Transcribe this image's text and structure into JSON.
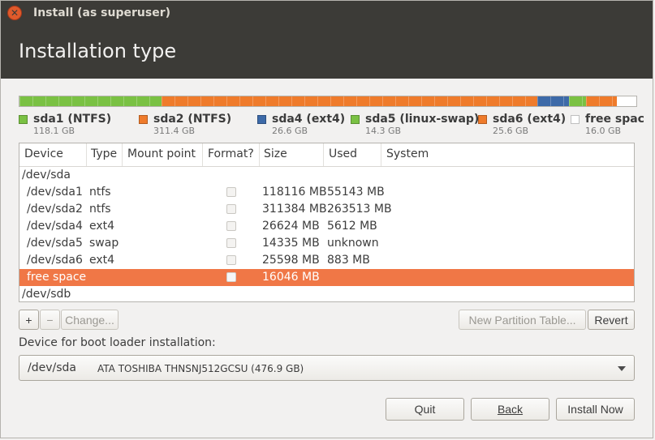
{
  "window": {
    "title": "Install (as superuser)"
  },
  "header": {
    "title": "Installation type"
  },
  "colors": {
    "ntfs": "#7ac143",
    "ntfs2": "#ef7b2b",
    "ext4_blue": "#3d6aa8",
    "swap": "#7ac143",
    "ext4_orange": "#ef7b2b",
    "free": "#ffffff",
    "selected_row": "#f07746",
    "header_bg": "#3c3b37"
  },
  "partition_bar": [
    {
      "name": "sda1",
      "size_gb": 118.1,
      "color": "#7ac143"
    },
    {
      "name": "sda2",
      "size_gb": 311.4,
      "color": "#ef7b2b"
    },
    {
      "name": "sda4",
      "size_gb": 26.6,
      "color": "#3d6aa8"
    },
    {
      "name": "sda5",
      "size_gb": 14.3,
      "color": "#7ac143"
    },
    {
      "name": "sda6",
      "size_gb": 25.6,
      "color": "#ef7b2b"
    },
    {
      "name": "free",
      "size_gb": 16.0,
      "color": "#ffffff"
    }
  ],
  "legend": [
    {
      "name": "sda1 (NTFS)",
      "size": "118.1 GB",
      "color": "#7ac143"
    },
    {
      "name": "sda2 (NTFS)",
      "size": "311.4 GB",
      "color": "#ef7b2b"
    },
    {
      "name": "sda4 (ext4)",
      "size": "26.6 GB",
      "color": "#3d6aa8"
    },
    {
      "name": "sda5 (linux-swap)",
      "size": "14.3 GB",
      "color": "#7ac143"
    },
    {
      "name": "sda6 (ext4)",
      "size": "25.6 GB",
      "color": "#ef7b2b"
    },
    {
      "name": "free spac",
      "size": "16.0 GB",
      "color": "#ffffff"
    }
  ],
  "table": {
    "headers": {
      "device": "Device",
      "type": "Type",
      "mount": "Mount point",
      "format": "Format?",
      "size": "Size",
      "used": "Used",
      "system": "System"
    },
    "rows": [
      {
        "device": "/dev/sda",
        "type": "",
        "size": "",
        "used": "",
        "checkbox": false,
        "selected": false,
        "group": true
      },
      {
        "device": "/dev/sda1",
        "type": "ntfs",
        "size": "118116 MB",
        "used": "55143 MB",
        "checkbox": true,
        "selected": false,
        "group": false
      },
      {
        "device": "/dev/sda2",
        "type": "ntfs",
        "size": "311384 MB",
        "used": "263513 MB",
        "checkbox": true,
        "selected": false,
        "group": false
      },
      {
        "device": "/dev/sda4",
        "type": "ext4",
        "size": "26624 MB",
        "used": "5612 MB",
        "checkbox": true,
        "selected": false,
        "group": false
      },
      {
        "device": "/dev/sda5",
        "type": "swap",
        "size": "14335 MB",
        "used": "unknown",
        "checkbox": true,
        "selected": false,
        "group": false
      },
      {
        "device": "/dev/sda6",
        "type": "ext4",
        "size": "25598 MB",
        "used": "883 MB",
        "checkbox": true,
        "selected": false,
        "group": false
      },
      {
        "device": "free space",
        "type": "",
        "size": "16046 MB",
        "used": "",
        "checkbox": true,
        "selected": true,
        "group": false
      },
      {
        "device": "/dev/sdb",
        "type": "",
        "size": "",
        "used": "",
        "checkbox": false,
        "selected": false,
        "group": true
      }
    ]
  },
  "toolbar": {
    "add": "+",
    "remove": "−",
    "change": "Change...",
    "new_table": "New Partition Table...",
    "revert": "Revert"
  },
  "bootloader": {
    "label": "Device for boot loader installation:",
    "device": "/dev/sda",
    "description": "ATA TOSHIBA THNSNJ512GCSU (476.9 GB)"
  },
  "buttons": {
    "quit": "Quit",
    "back": "Back",
    "install": "Install Now"
  }
}
